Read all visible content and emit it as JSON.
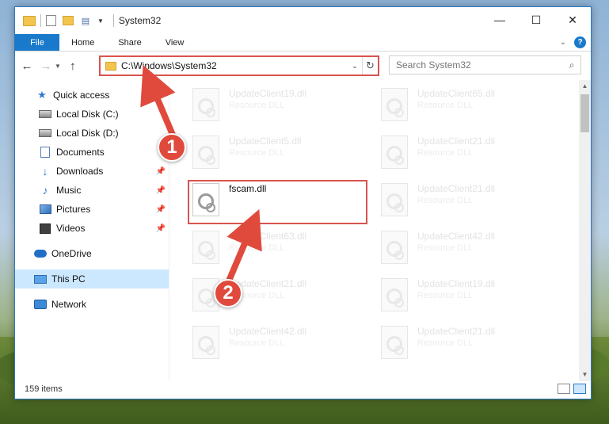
{
  "window": {
    "title": "System32",
    "controls": {
      "minimize": "—",
      "maximize": "☐",
      "close": "✕"
    }
  },
  "ribbon": {
    "tabs": [
      "File",
      "Home",
      "Share",
      "View"
    ],
    "help": "?"
  },
  "address": {
    "path": "C:\\Windows\\System32",
    "search_placeholder": "Search System32"
  },
  "nav": {
    "items": [
      {
        "label": "Quick access",
        "icon": "star-icon",
        "pinned": false
      },
      {
        "label": "Local Disk (C:)",
        "icon": "disk-icon",
        "pinned": false
      },
      {
        "label": "Local Disk (D:)",
        "icon": "disk-icon",
        "pinned": false
      },
      {
        "label": "Documents",
        "icon": "documents-icon",
        "pinned": false
      },
      {
        "label": "Downloads",
        "icon": "download-icon",
        "pinned": true
      },
      {
        "label": "Music",
        "icon": "music-icon",
        "pinned": true
      },
      {
        "label": "Pictures",
        "icon": "pictures-icon",
        "pinned": true
      },
      {
        "label": "Videos",
        "icon": "videos-icon",
        "pinned": true
      },
      {
        "label": "OneDrive",
        "icon": "onedrive-icon",
        "pinned": false
      },
      {
        "label": "This PC",
        "icon": "pc-icon",
        "pinned": false
      },
      {
        "label": "Network",
        "icon": "network-icon",
        "pinned": false
      }
    ]
  },
  "files": [
    {
      "name": "UpdateClient19.dll",
      "type": "Resource DLL"
    },
    {
      "name": "UpdateClient65.dll",
      "type": "Resource DLL"
    },
    {
      "name": "UpdateClient5.dll",
      "type": "Resource DLL"
    },
    {
      "name": "UpdateClient21.dll",
      "type": "Resource DLL"
    },
    {
      "name": "fscam.dll",
      "type": ""
    },
    {
      "name": "UpdateClient21.dll",
      "type": "Resource DLL"
    },
    {
      "name": "UpdateClient63.dll",
      "type": "Resource DLL"
    },
    {
      "name": "UpdateClient42.dll",
      "type": "Resource DLL"
    },
    {
      "name": "UpdateClient21.dll",
      "type": "Resource DLL"
    },
    {
      "name": "UpdateClient19.dll",
      "type": "Resource DLL"
    },
    {
      "name": "UpdateClient42.dll",
      "type": "Resource DLL"
    },
    {
      "name": "UpdateClient21.dll",
      "type": "Resource DLL"
    }
  ],
  "status": {
    "count": "159 items"
  },
  "callouts": {
    "one": "1",
    "two": "2"
  },
  "colors": {
    "accent": "#1979ca",
    "annotation": "#e04a3d",
    "selection": "#cce8ff"
  }
}
